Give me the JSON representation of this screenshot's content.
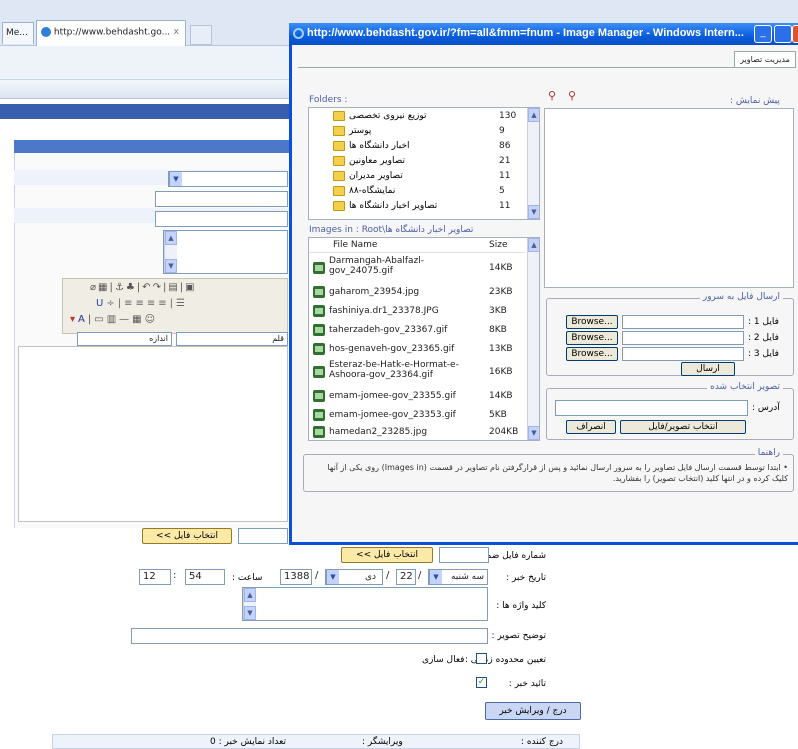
{
  "browser": {
    "tabs": [
      {
        "label": "Me..."
      },
      {
        "label": "http://www.behdasht.go...",
        "close": "x"
      }
    ]
  },
  "page": {
    "select_file_button": "<< انتخاب فایل",
    "labels": {
      "bulletin_number": "شماره فایل ضمیمه :",
      "news_date": "تاریخ خبر :",
      "hour": "ساعت :",
      "keywords": "کلید واژه ها :",
      "image_desc": "توضیح تصویر :",
      "time_limit": "تعیین محدوده زمانی :",
      "activate": "فعال سازی",
      "confirm": "تائید خبر :",
      "inserter": "درج کننده :",
      "editor": "ویرایشگر :",
      "views": "تعداد نمایش خبر : 0"
    },
    "date": {
      "weekday": "سه شنبه",
      "day": "22",
      "month": "دی",
      "year": "1388"
    },
    "time": {
      "hour": "12",
      "minute": "54"
    },
    "submit_button": "درج / ویرایش خبر",
    "size_label": "اندازه",
    "font_label": "قلم"
  },
  "popup": {
    "title": "http://www.behdasht.gov.ir/?fm=all&fmm=fnum - Image Manager - Windows Intern...",
    "tab": "مدیریت تصاویر",
    "folders_label": "Folders :",
    "preview_label": "پیش نمایش :",
    "folders": [
      {
        "name": "توزیع نیروی تخصصی",
        "count": "130"
      },
      {
        "name": "پوستر",
        "count": "9"
      },
      {
        "name": "اخبار دانشگاه ها",
        "count": "86"
      },
      {
        "name": "تصاویر معاونین",
        "count": "21"
      },
      {
        "name": "تصاویر مدیران",
        "count": "11"
      },
      {
        "name": "نمایشگاه-۸۸",
        "count": "5"
      },
      {
        "name": "تصاویر اخبار دانشگاه ها",
        "count": "11"
      }
    ],
    "images_in": "Images in : Root\\تصاویر اخبار دانشگاه ها",
    "file_header": {
      "name": "File Name",
      "size": "Size"
    },
    "files": [
      {
        "name": "Darmangah-Abalfazl-gov_24075.gif",
        "size": "14KB"
      },
      {
        "name": "gaharom_23954.jpg",
        "size": "23KB"
      },
      {
        "name": "fashiniya.dr1_23378.JPG",
        "size": "3KB"
      },
      {
        "name": "taherzadeh-gov_23367.gif",
        "size": "8KB"
      },
      {
        "name": "hos-genaveh-gov_23365.gif",
        "size": "13KB"
      },
      {
        "name": "Esteraz-be-Hatk-e-Hormat-e-Ashoora-gov_23364.gif",
        "size": "16KB"
      },
      {
        "name": "emam-jomee-gov_23355.gif",
        "size": "14KB"
      },
      {
        "name": "emam-jomee-gov_23353.gif",
        "size": "5KB"
      },
      {
        "name": "hamedan2_23285.jpg",
        "size": "204KB"
      }
    ],
    "upload_legend": "ارسال فایل به سرور",
    "upload_rows": [
      {
        "label": "فایل 1 :",
        "browse": "Browse..."
      },
      {
        "label": "فایل 2 :",
        "browse": "Browse..."
      },
      {
        "label": "فایل 3 :",
        "browse": "Browse..."
      }
    ],
    "send_button": "ارسال",
    "selected_legend": "تصویر انتخاب شده",
    "address_label": "آدرس :",
    "select_image_button": "انتخاب تصویر/فایل",
    "cancel_button": "انصراف",
    "help_legend": "راهنما",
    "help_text": "• ابتدا توسط قسمت ارسال فایل تصاویر را به سرور ارسال نمائید و پس از قرارگرفتن نام تصاویر در قسمت (Images in) روی یکی از آنها کلیک کرده و در انتها کلید (انتخاب تصویر) را بفشارید."
  }
}
